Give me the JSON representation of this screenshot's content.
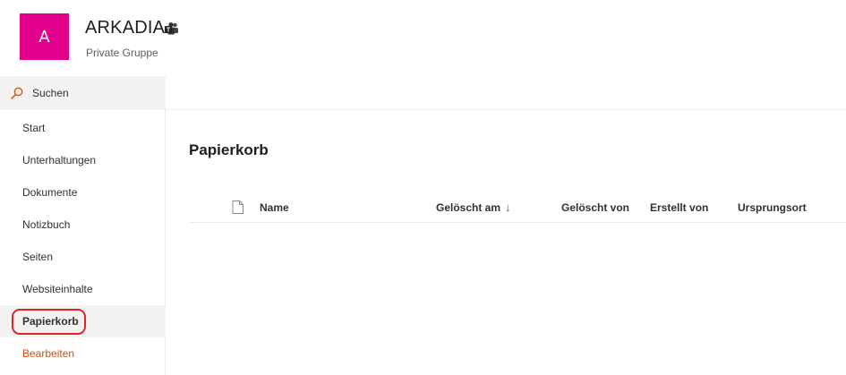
{
  "site": {
    "logo_letter": "A",
    "title": "ARKADIA",
    "subtitle": "Private Gruppe",
    "logo_color": "#e3008c",
    "title_icon": "teams-icon"
  },
  "search": {
    "label": "Suchen",
    "icon": "search-icon"
  },
  "nav": {
    "items": [
      {
        "label": "Start"
      },
      {
        "label": "Unterhaltungen"
      },
      {
        "label": "Dokumente"
      },
      {
        "label": "Notizbuch"
      },
      {
        "label": "Seiten"
      },
      {
        "label": "Websiteinhalte"
      },
      {
        "label": "Papierkorb",
        "selected": true
      },
      {
        "label": "Bearbeiten"
      }
    ],
    "edit_color": "#ca5010",
    "highlight_color": "#d9262c"
  },
  "main": {
    "title": "Papierkorb",
    "columns": {
      "file_type_icon": "document-icon",
      "name": "Name",
      "deleted_on": "Gelöscht am",
      "sort_indicator": "↓",
      "deleted_by": "Gelöscht von",
      "created_by": "Erstellt von",
      "origin": "Ursprungsort"
    }
  }
}
